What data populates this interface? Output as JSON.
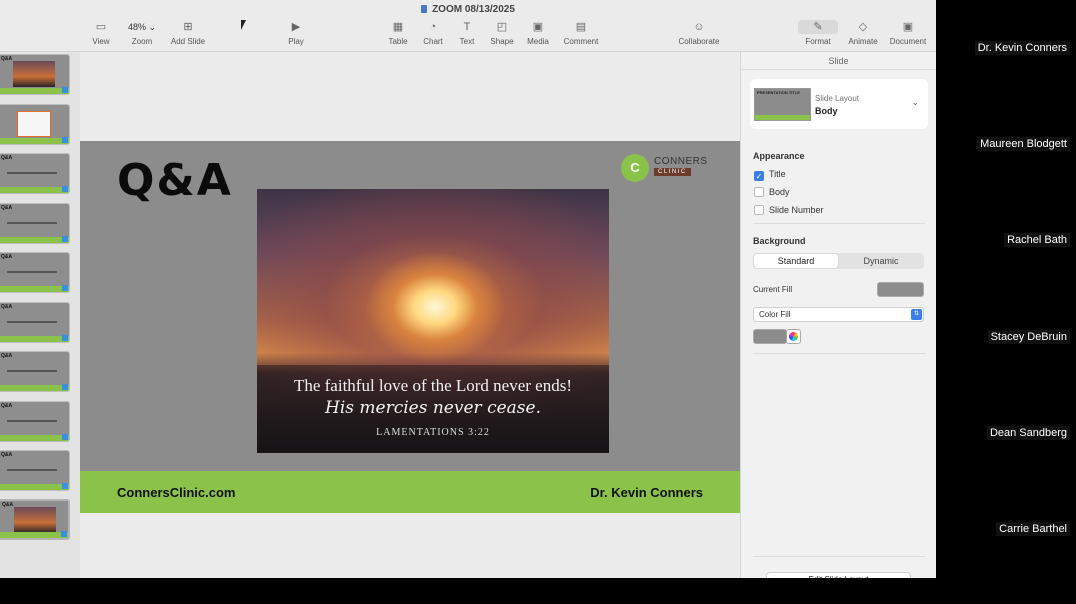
{
  "window": {
    "title": "ZOOM 08/13/2025"
  },
  "toolbar": {
    "left": [
      {
        "label": "View",
        "icon": "sidebar-icon"
      },
      {
        "label": "Zoom",
        "value": "48%",
        "icon": "chevron-down-icon"
      },
      {
        "label": "Add Slide",
        "icon": "plus-square-icon"
      }
    ],
    "play": {
      "label": "Play",
      "icon": "play-icon"
    },
    "insert": [
      {
        "label": "Table",
        "icon": "table-icon"
      },
      {
        "label": "Chart",
        "icon": "chart-icon"
      },
      {
        "label": "Text",
        "icon": "text-box-icon"
      },
      {
        "label": "Shape",
        "icon": "shape-icon"
      },
      {
        "label": "Media",
        "icon": "media-icon"
      },
      {
        "label": "Comment",
        "icon": "comment-icon"
      }
    ],
    "collaborate": {
      "label": "Collaborate",
      "icon": "collaborate-icon"
    },
    "right": [
      {
        "label": "Format",
        "icon": "paintbrush-icon"
      },
      {
        "label": "Animate",
        "icon": "diamond-icon"
      },
      {
        "label": "Document",
        "icon": "document-icon"
      }
    ]
  },
  "navigator": {
    "thumbs": [
      {
        "title": "Q&A",
        "kind": "image"
      },
      {
        "title": "",
        "kind": "content"
      },
      {
        "title": "Q&A",
        "kind": "text"
      },
      {
        "title": "Q&A",
        "kind": "text"
      },
      {
        "title": "Q&A",
        "kind": "text"
      },
      {
        "title": "Q&A",
        "kind": "text"
      },
      {
        "title": "Q&A",
        "kind": "text"
      },
      {
        "title": "Q&A",
        "kind": "text"
      },
      {
        "title": "Q&A",
        "kind": "text"
      },
      {
        "title": "Q&A",
        "kind": "image"
      }
    ]
  },
  "slide": {
    "title": "Q&A",
    "logo": {
      "name": "CONNERS",
      "sub": "CLINIC",
      "mark": "C"
    },
    "verse": {
      "line1": "The faithful love of the Lord never ends!",
      "line2": "His mercies never cease.",
      "ref": "LAMENTATIONS 3:22"
    },
    "footer": {
      "left": "ConnersClinic.com",
      "right": "Dr. Kevin Conners"
    },
    "colors": {
      "background": "#8c8c8c",
      "footer": "#8bc34a"
    }
  },
  "inspector": {
    "header": "Slide",
    "layout": {
      "caption": "Slide Layout",
      "value": "Body",
      "thumb_title": "PRESENTATION TITLE"
    },
    "appearance": {
      "label": "Appearance",
      "items": [
        {
          "label": "Title",
          "checked": true
        },
        {
          "label": "Body",
          "checked": false
        },
        {
          "label": "Slide Number",
          "checked": false
        }
      ]
    },
    "background": {
      "label": "Background",
      "segments": [
        "Standard",
        "Dynamic"
      ],
      "current_fill_label": "Current Fill",
      "fill_type": "Color Fill",
      "fill_color": "#8c8c8c"
    },
    "edit_layout_button": "Edit Slide Layout"
  },
  "participants": [
    "Dr. Kevin Conners",
    "Maureen Blodgett",
    "Rachel Bath",
    "Stacey DeBruin",
    "Dean Sandberg",
    "Carrie Barthel"
  ]
}
